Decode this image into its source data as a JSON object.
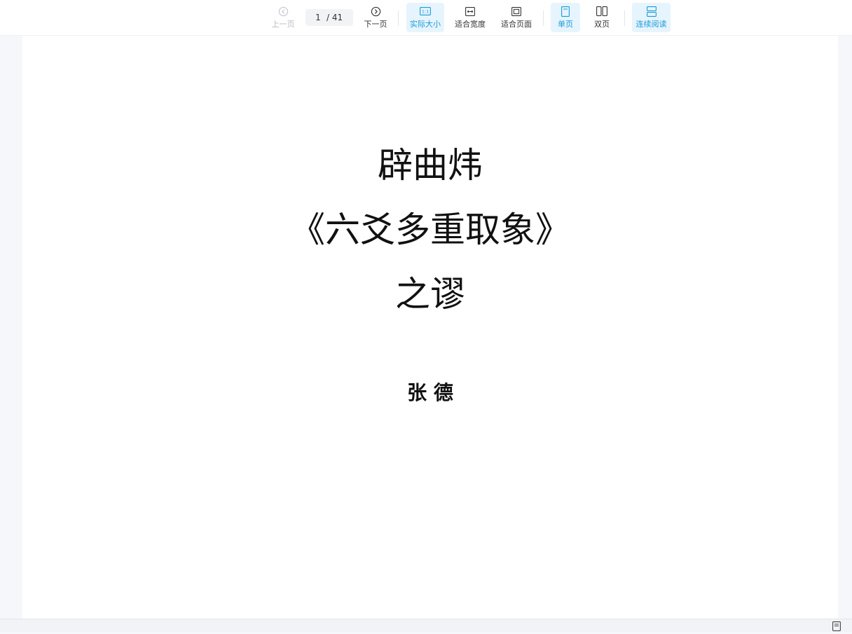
{
  "toolbar": {
    "prev_page_label": "上一页",
    "page_current": "1",
    "page_total": "/ 41",
    "next_page_label": "下一页",
    "actual_size_label": "实际大小",
    "actual_size_icon_text": "1:1",
    "fit_width_label": "适合宽度",
    "fit_page_label": "适合页面",
    "single_page_label": "单页",
    "double_page_label": "双页",
    "continuous_label": "连续阅读",
    "active_color": "#1a9bd8"
  },
  "document": {
    "title_line1": "辟曲炜",
    "title_line2": "《六爻多重取象》",
    "title_line3": "之谬",
    "author": "张 德"
  }
}
